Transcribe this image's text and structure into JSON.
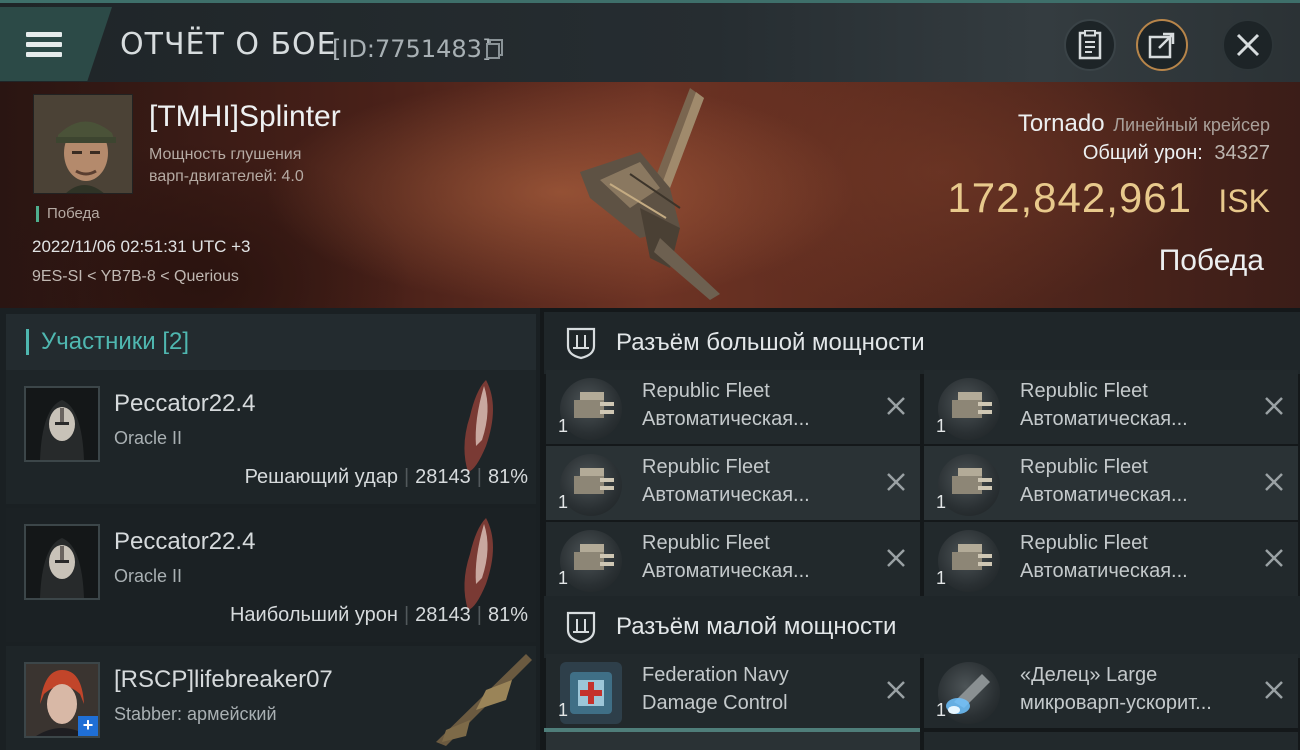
{
  "header": {
    "title": "ОТЧЁТ О БОЕ",
    "id_label": "[ID:7751483]"
  },
  "victim": {
    "name": "[TMHI]Splinter",
    "warp_line1": "Мощность глушения",
    "warp_line2": "варп-двигателей: 4.0",
    "result_small": "Победа",
    "datetime": "2022/11/06 02:51:31 UTC +3",
    "route": "9ES-SI < YB7B-8 < Querious",
    "ship_name": "Tornado",
    "ship_class": "Линейный крейсер",
    "total_damage_label": "Общий урон:",
    "total_damage": "34327",
    "isk_value": "172,842,961",
    "isk_unit": "ISK",
    "result_big": "Победа"
  },
  "participants": {
    "header": "Участники [2]",
    "rows": [
      {
        "name": "Peccator22.4",
        "ship": "Oracle II",
        "role": "Решающий удар",
        "damage": "28143",
        "percent": "81%"
      },
      {
        "name": "Peccator22.4",
        "ship": "Oracle II",
        "role": "Наибольший урон",
        "damage": "28143",
        "percent": "81%"
      },
      {
        "name": "[RSCP]lifebreaker07",
        "ship": "Stabber: армейский"
      }
    ]
  },
  "fitting": {
    "high_slots_title": "Разъём большой мощности",
    "low_slots_title": "Разъём малой мощности",
    "high_slots": [
      {
        "line1": "Republic Fleet",
        "line2": "Автоматическая...",
        "qty": "1"
      },
      {
        "line1": "Republic Fleet",
        "line2": "Автоматическая...",
        "qty": "1"
      },
      {
        "line1": "Republic Fleet",
        "line2": "Автоматическая...",
        "qty": "1"
      },
      {
        "line1": "Republic Fleet",
        "line2": "Автоматическая...",
        "qty": "1"
      },
      {
        "line1": "Republic Fleet",
        "line2": "Автоматическая...",
        "qty": "1"
      },
      {
        "line1": "Republic Fleet",
        "line2": "Автоматическая...",
        "qty": "1"
      }
    ],
    "low_slots": [
      {
        "line1": "Federation Navy",
        "line2": "Damage Control",
        "qty": "1"
      },
      {
        "line1": "«Делец» Large",
        "line2": "микроварп-ускорит...",
        "qty": "1"
      }
    ]
  },
  "icons": {
    "menu": "hamburger-icon",
    "copy": "copy-icon",
    "notes": "clipboard-icon",
    "share": "share-icon",
    "close": "close-icon",
    "section": "shield-slot-icon",
    "destroyed": "x-mark-icon"
  },
  "colors": {
    "accent_teal": "#4fb7b0",
    "isk_gold": "#e8c98c",
    "win_green": "#4fae8e",
    "share_ring": "#b7854a"
  }
}
